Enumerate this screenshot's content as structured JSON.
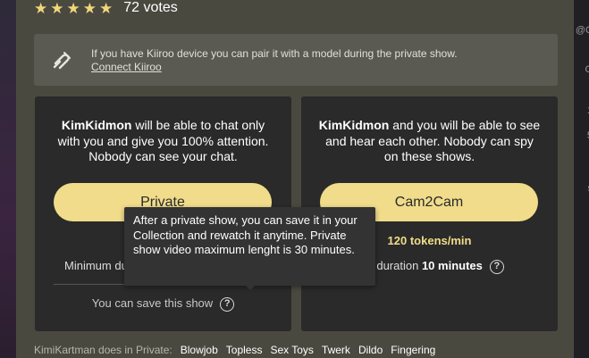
{
  "rating": {
    "stars": 5,
    "votes": "72 votes"
  },
  "kiiroo": {
    "text": "If you have Kiiroo device you can pair it with a model during the private show.",
    "link": "Connect Kiiroo",
    "icon": "kiiroo-device-icon"
  },
  "private": {
    "model": "KimKidmon",
    "desc": " will be able to chat only with you and give you 100% attention. Nobody can see your chat.",
    "button": "Private",
    "min_label": "Minimum duration",
    "save_text": "You can save this show"
  },
  "cam2cam": {
    "model": "KimKidmon",
    "desc": " and you will be able to see and hear each other. Nobody can spy on these shows.",
    "button": "Cam2Cam",
    "price": "120 tokens/min",
    "min_label": "Minimum duration",
    "min_value": "10 minutes"
  },
  "tooltip": "After a private show, you can save it in your Collection and rewatch it anytime. Private show video maximum lenght is 30 minutes.",
  "tags": {
    "label": "KimiKartman does in Private:",
    "items": [
      "Blowjob",
      "Topless",
      "Sex Toys",
      "Twerk",
      "Dildo",
      "Fingering"
    ]
  },
  "side_glyphs": [
    "@C",
    "G",
    "1",
    "5",
    "s"
  ],
  "colors": {
    "accent": "#f0dc8a",
    "modal_bg": "#4a4940",
    "card_bg": "#2a2a2a"
  }
}
